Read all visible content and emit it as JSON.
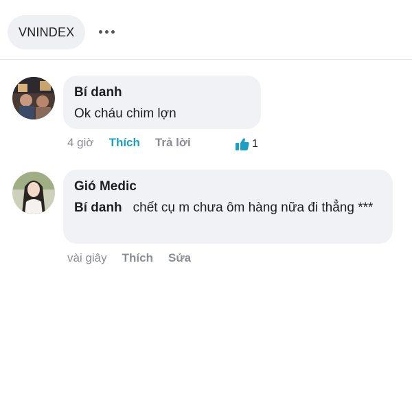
{
  "header": {
    "chip_label": "VNINDEX",
    "more_icon": "more-horizontal-icon"
  },
  "comments": [
    {
      "author": "Bí danh",
      "text": "Ok cháu chim lợn",
      "time": "4 giờ",
      "actions": [
        "Thích",
        "Trả lời"
      ],
      "liked": true,
      "like_count": "1",
      "like_icon": "thumbs-up-icon"
    },
    {
      "author": "Gió Medic",
      "mention": "Bí danh",
      "text": "chết cụ m chưa ôm hàng nữa đi thẳng ***",
      "time": "vài giây",
      "actions": [
        "Thích",
        "Sửa"
      ]
    }
  ],
  "colors": {
    "accent": "#1aa0c6",
    "bubble": "#f0f2f5",
    "muted": "#8a8d91"
  }
}
